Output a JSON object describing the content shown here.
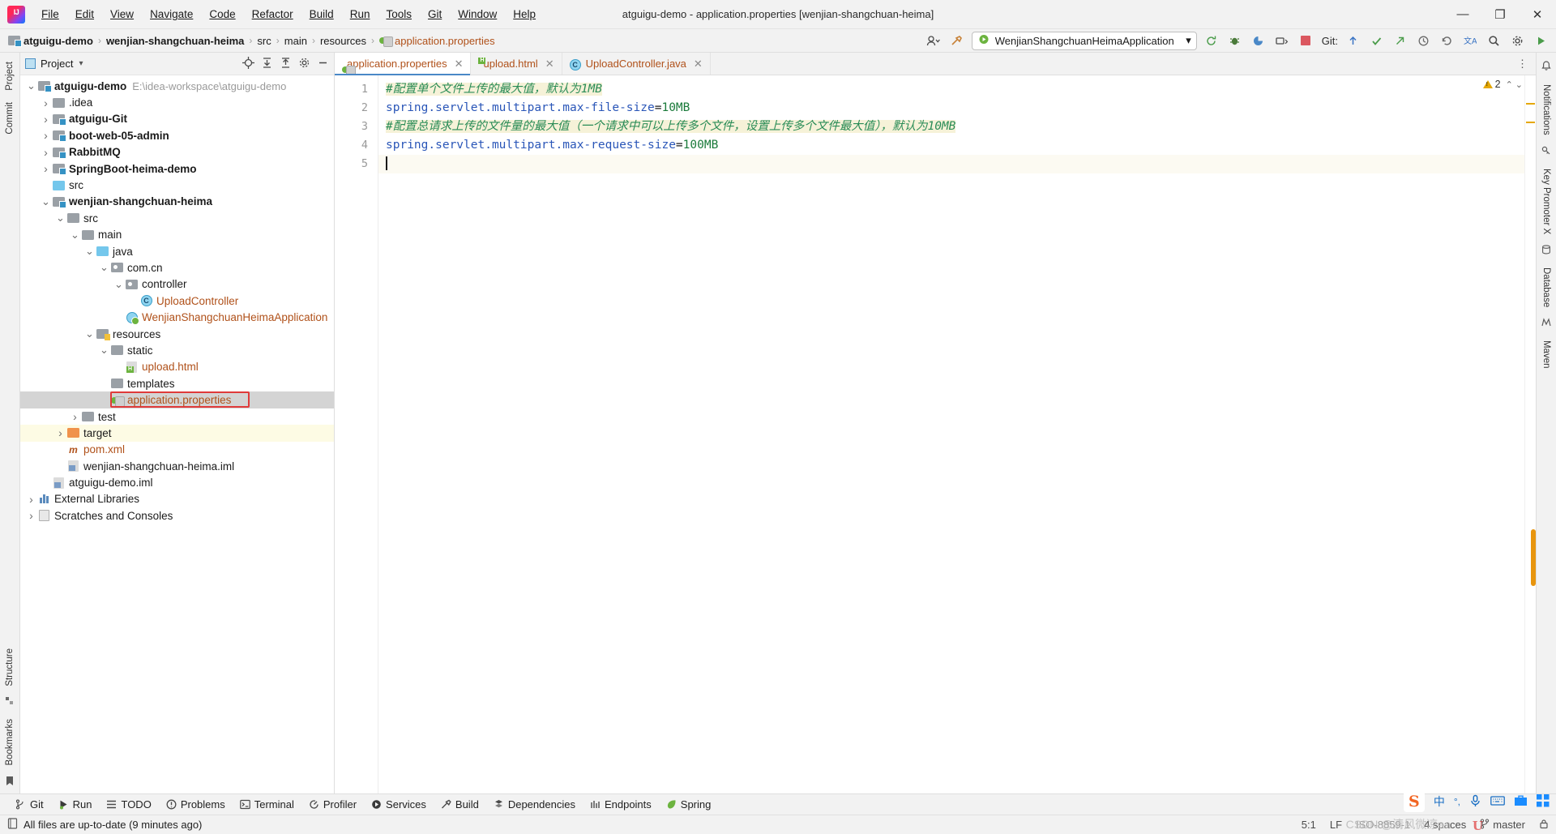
{
  "window": {
    "title": "atguigu-demo - application.properties [wenjian-shangchuan-heima]",
    "minimize": "—",
    "maximize": "❐",
    "close": "✕",
    "logo_text": "IJ"
  },
  "menubar": [
    {
      "label": "File"
    },
    {
      "label": "Edit"
    },
    {
      "label": "View"
    },
    {
      "label": "Navigate"
    },
    {
      "label": "Code"
    },
    {
      "label": "Refactor"
    },
    {
      "label": "Build"
    },
    {
      "label": "Run"
    },
    {
      "label": "Tools"
    },
    {
      "label": "Git"
    },
    {
      "label": "Window"
    },
    {
      "label": "Help"
    }
  ],
  "navbar": {
    "crumbs": [
      {
        "label": "atguigu-demo",
        "bold": true,
        "type": "project"
      },
      {
        "label": "wenjian-shangchuan-heima",
        "bold": true,
        "type": "module"
      },
      {
        "label": "src",
        "bold": false,
        "type": "folder"
      },
      {
        "label": "main",
        "bold": false,
        "type": "folder"
      },
      {
        "label": "resources",
        "bold": false,
        "type": "folder"
      },
      {
        "label": "application.properties",
        "bold": false,
        "type": "file"
      }
    ],
    "separator": "›",
    "run_config": "WenjianShangchuanHeimaApplication",
    "git_label": "Git:",
    "icons": {
      "avatar": "user-avatar-icon",
      "hammer": "build-hammer-icon",
      "rerun": "rerun-icon",
      "debug": "debug-icon",
      "coverage": "coverage-icon",
      "profile": "profiler-icon",
      "stop": "stop-icon",
      "update": "git-update-icon",
      "commit": "git-commit-icon",
      "push": "git-push-icon",
      "history": "git-history-icon",
      "rollback": "git-rollback-icon",
      "translate": "translate-icon",
      "search": "search-everywhere-icon",
      "settings": "settings-gear-icon",
      "run_play": "run-play-icon"
    }
  },
  "left_rail": [
    {
      "label": "Project"
    },
    {
      "label": "Commit"
    },
    {
      "label": "Structure"
    },
    {
      "label": "Bookmarks"
    }
  ],
  "right_rail": [
    {
      "label": "Notifications"
    },
    {
      "label": "Key Promoter X"
    },
    {
      "label": "Database"
    },
    {
      "label": "Maven"
    }
  ],
  "project_panel": {
    "title": "Project",
    "dropdown": "▾",
    "actions": [
      "locate-icon",
      "expand-all-icon",
      "collapse-all-icon",
      "settings-icon",
      "hide-icon"
    ],
    "tree": [
      {
        "depth": 0,
        "arrow": "down",
        "icon": "module-folder",
        "label": "atguigu-demo",
        "bold": true,
        "path": "E:\\idea-workspace\\atguigu-demo"
      },
      {
        "depth": 1,
        "arrow": "right",
        "icon": "grey-folder",
        "label": ".idea",
        "bold": false
      },
      {
        "depth": 1,
        "arrow": "right",
        "icon": "module-folder",
        "label": "atguigu-Git",
        "bold": true
      },
      {
        "depth": 1,
        "arrow": "right",
        "icon": "module-folder",
        "label": "boot-web-05-admin",
        "bold": true
      },
      {
        "depth": 1,
        "arrow": "right",
        "icon": "module-folder",
        "label": "RabbitMQ",
        "bold": true
      },
      {
        "depth": 1,
        "arrow": "right",
        "icon": "module-folder",
        "label": "SpringBoot-heima-demo",
        "bold": true
      },
      {
        "depth": 1,
        "arrow": "none",
        "icon": "blue-folder",
        "label": "src",
        "bold": false
      },
      {
        "depth": 1,
        "arrow": "down",
        "icon": "module-folder",
        "label": "wenjian-shangchuan-heima",
        "bold": true
      },
      {
        "depth": 2,
        "arrow": "down",
        "icon": "grey-folder",
        "label": "src",
        "bold": false
      },
      {
        "depth": 3,
        "arrow": "down",
        "icon": "grey-folder",
        "label": "main",
        "bold": false
      },
      {
        "depth": 4,
        "arrow": "down",
        "icon": "blue-folder",
        "label": "java",
        "bold": false
      },
      {
        "depth": 5,
        "arrow": "down",
        "icon": "package",
        "label": "com.cn",
        "bold": false
      },
      {
        "depth": 6,
        "arrow": "down",
        "icon": "package",
        "label": "controller",
        "bold": false
      },
      {
        "depth": 7,
        "arrow": "none",
        "icon": "java-class",
        "label": "UploadController",
        "bold": false,
        "orange": true
      },
      {
        "depth": 6,
        "arrow": "none",
        "icon": "spring-boot-class",
        "label": "WenjianShangchuanHeimaApplication",
        "bold": false,
        "orange": true
      },
      {
        "depth": 4,
        "arrow": "down",
        "icon": "resources-folder",
        "label": "resources",
        "bold": false
      },
      {
        "depth": 5,
        "arrow": "down",
        "icon": "grey-folder",
        "label": "static",
        "bold": false
      },
      {
        "depth": 6,
        "arrow": "none",
        "icon": "html-file",
        "label": "upload.html",
        "bold": false,
        "orange": true
      },
      {
        "depth": 5,
        "arrow": "none",
        "icon": "grey-folder",
        "label": "templates",
        "bold": false
      },
      {
        "depth": 5,
        "arrow": "none",
        "icon": "properties-file",
        "label": "application.properties",
        "bold": false,
        "orange": true,
        "selected": true,
        "highlighted": true
      },
      {
        "depth": 3,
        "arrow": "right",
        "icon": "grey-folder",
        "label": "test",
        "bold": false
      },
      {
        "depth": 2,
        "arrow": "right",
        "icon": "orange-folder",
        "label": "target",
        "bold": false,
        "target": true
      },
      {
        "depth": 2,
        "arrow": "none",
        "icon": "maven-xml",
        "label": "pom.xml",
        "bold": false,
        "orange": true
      },
      {
        "depth": 2,
        "arrow": "none",
        "icon": "iml-file",
        "label": "wenjian-shangchuan-heima.iml",
        "bold": false
      },
      {
        "depth": 1,
        "arrow": "none",
        "icon": "iml-file",
        "label": "atguigu-demo.iml",
        "bold": false
      },
      {
        "depth": 0,
        "arrow": "right",
        "icon": "library",
        "label": "External Libraries",
        "bold": false
      },
      {
        "depth": 0,
        "arrow": "right",
        "icon": "scratch",
        "label": "Scratches and Consoles",
        "bold": false
      }
    ]
  },
  "editor": {
    "tabs": [
      {
        "label": "application.properties",
        "icon": "properties-file",
        "active": true,
        "orange": true,
        "close": "✕"
      },
      {
        "label": "upload.html",
        "icon": "html-file",
        "active": false,
        "orange": true,
        "close": "✕"
      },
      {
        "label": "UploadController.java",
        "icon": "java-class",
        "active": false,
        "orange": true,
        "close": "✕"
      }
    ],
    "more_icon": "⋮",
    "inspection": {
      "count": "2",
      "warning_icon": "warning-triangle-icon",
      "up": "⌃",
      "down": "⌄"
    },
    "line_numbers": [
      "1",
      "2",
      "3",
      "4",
      "5"
    ],
    "lines": [
      {
        "n": 1,
        "type": "comment",
        "text": "#配置单个文件上传的最大值，默认为1MB"
      },
      {
        "n": 2,
        "type": "property",
        "key": "spring.servlet.multipart.max-file-size",
        "eq": "=",
        "value": "10MB"
      },
      {
        "n": 3,
        "type": "comment",
        "text": "#配置总请求上传的文件量的最大值（一个请求中可以上传多个文件，设置上传多个文件最大值），默认为10MB"
      },
      {
        "n": 4,
        "type": "property",
        "key": "spring.servlet.multipart.max-request-size",
        "eq": "=",
        "value": "100MB"
      },
      {
        "n": 5,
        "type": "empty",
        "text": ""
      }
    ]
  },
  "bottom_tools": [
    {
      "label": "Git",
      "icon": "git-branch-icon"
    },
    {
      "label": "Run",
      "icon": "run-play-icon"
    },
    {
      "label": "TODO",
      "icon": "todo-list-icon"
    },
    {
      "label": "Problems",
      "icon": "problems-icon"
    },
    {
      "label": "Terminal",
      "icon": "terminal-icon"
    },
    {
      "label": "Profiler",
      "icon": "profiler-icon"
    },
    {
      "label": "Services",
      "icon": "services-icon"
    },
    {
      "label": "Build",
      "icon": "build-hammer-icon"
    },
    {
      "label": "Dependencies",
      "icon": "dependencies-icon"
    },
    {
      "label": "Endpoints",
      "icon": "endpoints-icon"
    },
    {
      "label": "Spring",
      "icon": "spring-leaf-icon"
    }
  ],
  "statusbar": {
    "message": "All files are up-to-date (9 minutes ago)",
    "message_icon": "document-icon",
    "caret": "5:1",
    "line_separator": "LF",
    "encoding": "ISO-8859-1",
    "indent": "4 spaces",
    "branch": "master",
    "branch_icon": "git-branch-icon",
    "lock_icon": "lock-icon"
  },
  "ime_tray": {
    "sogou": "S",
    "lang": "中",
    "punct": "°,",
    "mic": "microphone-icon",
    "keyboard": "keyboard-icon",
    "toolbox": "toolbox-icon",
    "apps": "apps-grid-icon",
    "watermark": "CSDN @清风微凉aa",
    "u_mark": "U"
  },
  "colors": {
    "accent": "#4a88c7",
    "comment": "#2a8c56",
    "key": "#2a56b8",
    "value": "#1a7a3a",
    "orange_file": "#b0511a",
    "highlight_box": "#e03a3a",
    "selected_row": "#d4d4d4",
    "comment_bg": "#f6f2d8"
  }
}
